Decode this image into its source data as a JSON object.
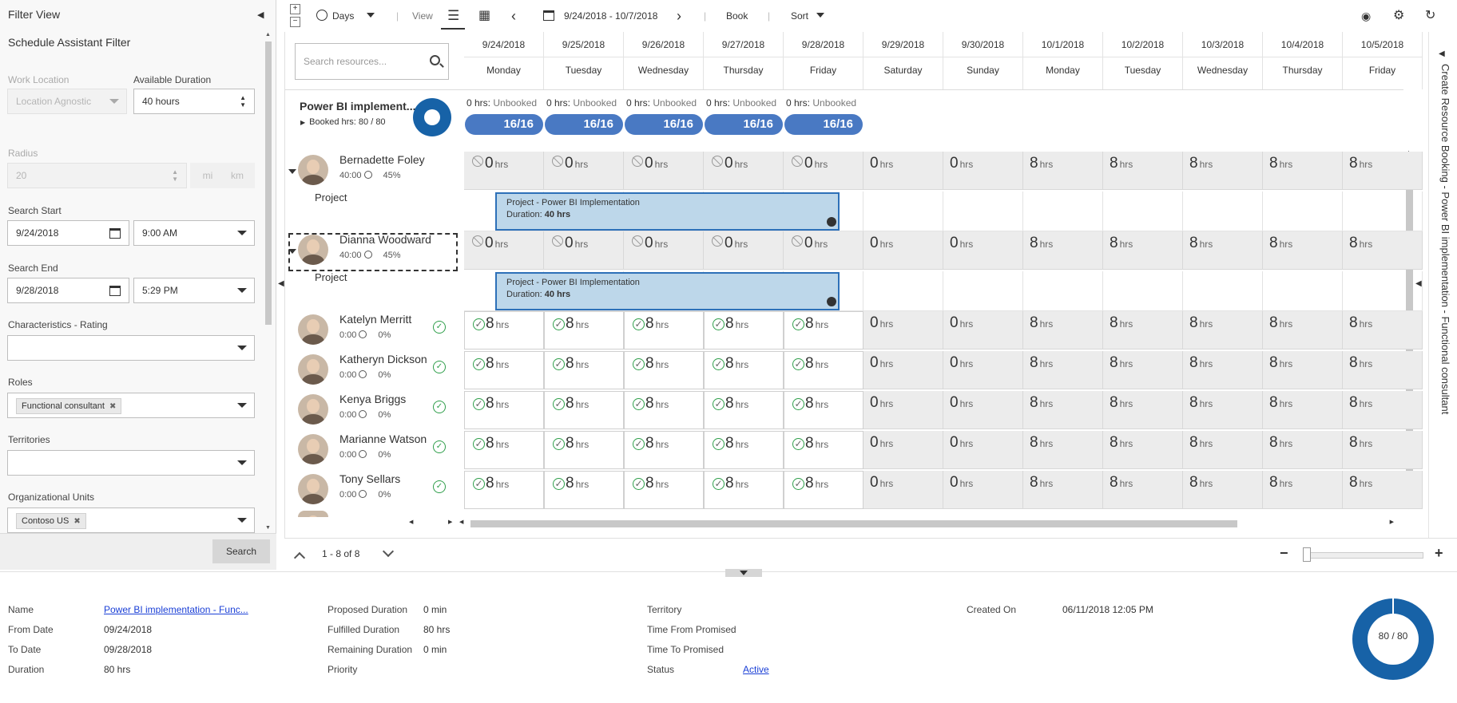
{
  "filter": {
    "title": "Filter View",
    "subtitle": "Schedule Assistant Filter",
    "work_location_label": "Work Location",
    "work_location_value": "Location Agnostic",
    "available_duration_label": "Available Duration",
    "available_duration_value": "40 hours",
    "radius_label": "Radius",
    "radius_value": "20",
    "radius_unit_mi": "mi",
    "radius_unit_km": "km",
    "search_start_label": "Search Start",
    "search_start_date": "9/24/2018",
    "search_start_time": "9:00 AM",
    "search_end_label": "Search End",
    "search_end_date": "9/28/2018",
    "search_end_time": "5:29 PM",
    "characteristics_label": "Characteristics - Rating",
    "roles_label": "Roles",
    "roles_tag": "Functional consultant",
    "territories_label": "Territories",
    "org_units_label": "Organizational Units",
    "org_units_tag": "Contoso US",
    "search_button": "Search"
  },
  "toolbar": {
    "days_label": "Days",
    "view_label": "View",
    "date_range": "9/24/2018 - 10/7/2018",
    "book_label": "Book",
    "sort_label": "Sort"
  },
  "grid": {
    "search_placeholder": "Search resources...",
    "days": [
      {
        "date": "9/24/2018",
        "weekday": "Monday"
      },
      {
        "date": "9/25/2018",
        "weekday": "Tuesday"
      },
      {
        "date": "9/26/2018",
        "weekday": "Wednesday"
      },
      {
        "date": "9/27/2018",
        "weekday": "Thursday"
      },
      {
        "date": "9/28/2018",
        "weekday": "Friday"
      },
      {
        "date": "9/29/2018",
        "weekday": "Saturday"
      },
      {
        "date": "9/30/2018",
        "weekday": "Sunday"
      },
      {
        "date": "10/1/2018",
        "weekday": "Monday"
      },
      {
        "date": "10/2/2018",
        "weekday": "Tuesday"
      },
      {
        "date": "10/3/2018",
        "weekday": "Wednesday"
      },
      {
        "date": "10/4/2018",
        "weekday": "Thursday"
      },
      {
        "date": "10/5/2018",
        "weekday": "Friday"
      }
    ],
    "requirement": {
      "name": "Power BI implement...",
      "booked": "Booked hrs: 80 / 80",
      "unbooked": [
        "0 hrs: Unbooked",
        "0 hrs: Unbooked",
        "0 hrs: Unbooked",
        "0 hrs: Unbooked",
        "0 hrs: Unbooked"
      ],
      "pills": [
        "16/16",
        "16/16",
        "16/16",
        "16/16",
        "16/16"
      ]
    },
    "project_label": "Project",
    "booking_title": "Project - Power BI Implementation",
    "booking_duration_label": "Duration:",
    "booking_duration_value": "40 hrs",
    "hrs_unit": "hrs",
    "resources": [
      {
        "name": "Bernadette Foley",
        "hours": "40:00",
        "pct": "45%",
        "values": [
          "0",
          "0",
          "0",
          "0",
          "0",
          "0",
          "0",
          "8",
          "8",
          "8",
          "8",
          "8"
        ],
        "unavailable": 5,
        "green": 0,
        "project": true
      },
      {
        "name": "Dianna Woodward",
        "hours": "40:00",
        "pct": "45%",
        "values": [
          "0",
          "0",
          "0",
          "0",
          "0",
          "0",
          "0",
          "8",
          "8",
          "8",
          "8",
          "8"
        ],
        "unavailable": 5,
        "green": 0,
        "project": true,
        "selected": true
      },
      {
        "name": "Katelyn Merritt",
        "hours": "0:00",
        "pct": "0%",
        "values": [
          "8",
          "8",
          "8",
          "8",
          "8",
          "0",
          "0",
          "8",
          "8",
          "8",
          "8",
          "8"
        ],
        "unavailable": 0,
        "green": 5,
        "project": false
      },
      {
        "name": "Katheryn Dickson",
        "hours": "0:00",
        "pct": "0%",
        "values": [
          "8",
          "8",
          "8",
          "8",
          "8",
          "0",
          "0",
          "8",
          "8",
          "8",
          "8",
          "8"
        ],
        "unavailable": 0,
        "green": 5,
        "project": false
      },
      {
        "name": "Kenya Briggs",
        "hours": "0:00",
        "pct": "0%",
        "values": [
          "8",
          "8",
          "8",
          "8",
          "8",
          "0",
          "0",
          "8",
          "8",
          "8",
          "8",
          "8"
        ],
        "unavailable": 0,
        "green": 5,
        "project": false
      },
      {
        "name": "Marianne Watson",
        "hours": "0:00",
        "pct": "0%",
        "values": [
          "8",
          "8",
          "8",
          "8",
          "8",
          "0",
          "0",
          "8",
          "8",
          "8",
          "8",
          "8"
        ],
        "unavailable": 0,
        "green": 5,
        "project": false
      },
      {
        "name": "Tony Sellars",
        "hours": "0:00",
        "pct": "0%",
        "values": [
          "8",
          "8",
          "8",
          "8",
          "8",
          "0",
          "0",
          "8",
          "8",
          "8",
          "8",
          "8"
        ],
        "unavailable": 0,
        "green": 5,
        "project": false
      }
    ]
  },
  "side_panel": {
    "text": "Create Resource Booking - Power BI implementation - Functional consultant"
  },
  "pager": {
    "range": "1 - 8 of 8"
  },
  "details": {
    "name_label": "Name",
    "name_value": "Power BI implementation - Func...",
    "from_label": "From Date",
    "from_value": "09/24/2018",
    "to_label": "To Date",
    "to_value": "09/28/2018",
    "duration_label": "Duration",
    "duration_value": "80 hrs",
    "proposed_label": "Proposed Duration",
    "proposed_value": "0 min",
    "fulfilled_label": "Fulfilled Duration",
    "fulfilled_value": "80 hrs",
    "remaining_label": "Remaining Duration",
    "remaining_value": "0 min",
    "priority_label": "Priority",
    "territory_label": "Territory",
    "time_from_label": "Time From Promised",
    "time_to_label": "Time To Promised",
    "status_label": "Status",
    "status_value": "Active",
    "created_label": "Created On",
    "created_value": "06/11/2018 12:05 PM",
    "donut_label": "80 / 80"
  },
  "colors": {
    "accent": "#1762a7",
    "pill": "#4979c3",
    "booking_fill": "#bdd7ea",
    "available": "#2e9e4a"
  }
}
